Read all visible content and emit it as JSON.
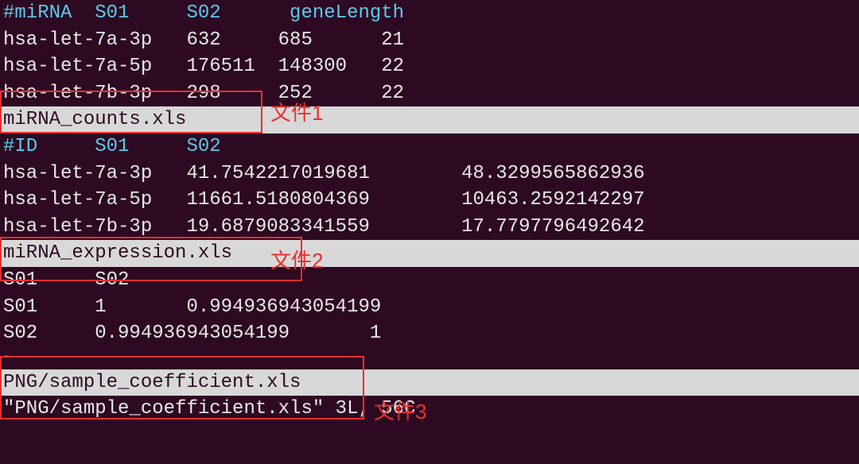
{
  "block1": {
    "header": "#miRNA  S01     S02      geneLength",
    "rows": [
      "hsa-let-7a-3p   632     685      21",
      "hsa-let-7a-5p   176511  148300   22",
      "hsa-let-7b-3p   298     252      22"
    ],
    "filename": "miRNA_counts.xls"
  },
  "block2": {
    "header": "#ID     S01     S02",
    "rows": [
      "hsa-let-7a-3p   41.7542217019681        48.3299565862936",
      "hsa-let-7a-5p   11661.5180804369        10463.2592142297",
      "hsa-let-7b-3p   19.6879083341559        17.7797796492642"
    ],
    "filename": "miRNA_expression.xls"
  },
  "block3": {
    "header": "S01     S02",
    "rows": [
      "S01     1       0.994936943054199",
      "S02     0.994936943054199       1"
    ],
    "filename": "PNG/sample_coefficient.xls"
  },
  "status": "\"PNG/sample_coefficient.xls\" 3L, 56C",
  "annotations": {
    "label1": "文件1",
    "label2": "文件2",
    "label3": "文件3"
  },
  "tilde": "~"
}
